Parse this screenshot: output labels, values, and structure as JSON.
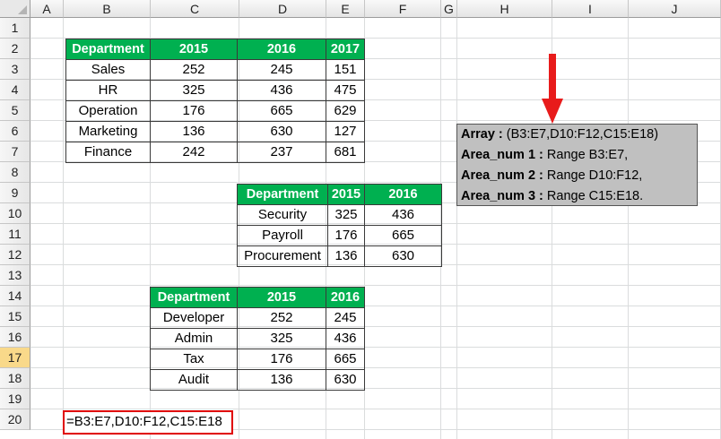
{
  "columns": [
    "A",
    "B",
    "C",
    "D",
    "E",
    "F",
    "G",
    "H",
    "I",
    "J"
  ],
  "rows": [
    "1",
    "2",
    "3",
    "4",
    "5",
    "6",
    "7",
    "8",
    "9",
    "10",
    "11",
    "12",
    "13",
    "14",
    "15",
    "16",
    "17",
    "18",
    "19",
    "20"
  ],
  "active_row": "17",
  "table1": {
    "headers": [
      "Department",
      "2015",
      "2016",
      "2017"
    ],
    "rows": [
      [
        "Sales",
        "252",
        "245",
        "151"
      ],
      [
        "HR",
        "325",
        "436",
        "475"
      ],
      [
        "Operation",
        "176",
        "665",
        "629"
      ],
      [
        "Marketing",
        "136",
        "630",
        "127"
      ],
      [
        "Finance",
        "242",
        "237",
        "681"
      ]
    ]
  },
  "table2": {
    "headers": [
      "Department",
      "2015",
      "2016"
    ],
    "rows": [
      [
        "Security",
        "325",
        "436"
      ],
      [
        "Payroll",
        "176",
        "665"
      ],
      [
        "Procurement",
        "136",
        "630"
      ]
    ]
  },
  "table3": {
    "headers": [
      "Department",
      "2015",
      "2016"
    ],
    "rows": [
      [
        "Developer",
        "252",
        "245"
      ],
      [
        "Admin",
        "325",
        "436"
      ],
      [
        "Tax",
        "176",
        "665"
      ],
      [
        "Audit",
        "136",
        "630"
      ]
    ]
  },
  "callout": {
    "lines": [
      {
        "key": "Array :",
        "value": " (B3:E7,D10:F12,C15:E18)"
      },
      {
        "key": "Area_num 1 :",
        "value": " Range B3:E7,"
      },
      {
        "key": "Area_num 2 :",
        "value": " Range D10:F12,"
      },
      {
        "key": "Area_num 3 :",
        "value": " Range C15:E18."
      }
    ]
  },
  "formula": "=B3:E7,D10:F12,C15:E18",
  "colors": {
    "header_green": "#00b050",
    "callout_bg": "#c0c0c0",
    "highlight_red": "#e00000",
    "arrow_red": "#e81b1b"
  }
}
